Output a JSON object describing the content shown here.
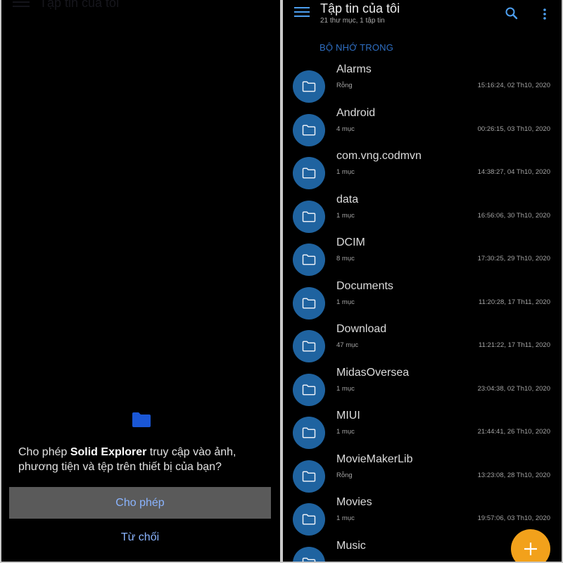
{
  "left": {
    "faded_title": "Tập tin của tôi",
    "dialog": {
      "message_prefix": "Cho phép ",
      "message_app": "Solid Explorer",
      "message_suffix": " truy cập vào ảnh, phương tiện và tệp trên thiết bị của bạn?",
      "allow_label": "Cho phép",
      "deny_label": "Từ chối"
    }
  },
  "right": {
    "title": "Tập tin của tôi",
    "subtitle": "21 thư mục, 1 tập tin",
    "storage_tab": "BỘ NHỚ TRONG",
    "icons": [
      "menu-icon",
      "search-icon",
      "more-vertical-icon",
      "folder-icon",
      "plus-icon"
    ],
    "colors": {
      "accent": "#4d9ff0",
      "folder_avatar": "#1f63a0",
      "fab": "#f2a11b"
    },
    "files": [
      {
        "name": "Alarms",
        "meta": "Rỗng",
        "date": "15:16:24, 02 Th10, 2020"
      },
      {
        "name": "Android",
        "meta": "4 mục",
        "date": "00:26:15, 03 Th10, 2020"
      },
      {
        "name": "com.vng.codmvn",
        "meta": "1 mục",
        "date": "14:38:27, 04 Th10, 2020"
      },
      {
        "name": "data",
        "meta": "1 mục",
        "date": "16:56:06, 30 Th10, 2020"
      },
      {
        "name": "DCIM",
        "meta": "8 mục",
        "date": "17:30:25, 29 Th10, 2020"
      },
      {
        "name": "Documents",
        "meta": "1 mục",
        "date": "11:20:28, 17 Th11, 2020"
      },
      {
        "name": "Download",
        "meta": "47 mục",
        "date": "11:21:22, 17 Th11, 2020"
      },
      {
        "name": "MidasOversea",
        "meta": "1 mục",
        "date": "23:04:38, 02 Th10, 2020"
      },
      {
        "name": "MIUI",
        "meta": "1 mục",
        "date": "21:44:41, 26 Th10, 2020"
      },
      {
        "name": "MovieMakerLib",
        "meta": "Rỗng",
        "date": "13:23:08, 28 Th10, 2020"
      },
      {
        "name": "Movies",
        "meta": "1 mục",
        "date": "19:57:06, 03 Th10, 2020"
      },
      {
        "name": "Music",
        "meta": "",
        "date": ""
      }
    ]
  }
}
